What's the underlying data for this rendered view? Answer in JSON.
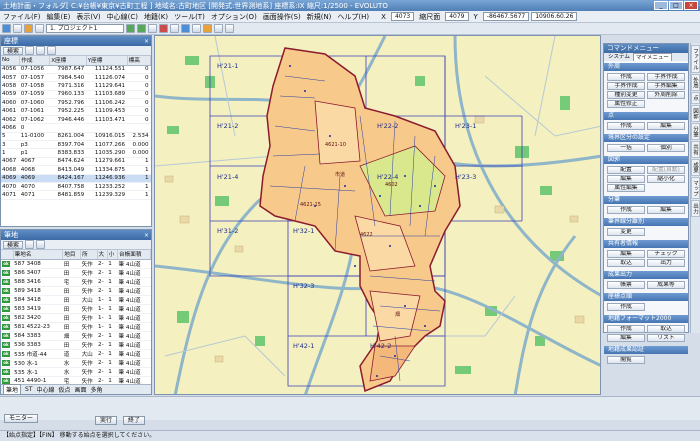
{
  "window": {
    "title": "土地計画・フォルダ[ C:¥台帳¥東京¥古町工程 ] 地域名:古町地区 [開発式:世界測地系] 座標系:IX 縮尺:1/2500 - EVOLUTO"
  },
  "menu": {
    "items": [
      "ファイル(F)",
      "編集(E)",
      "表示(V)",
      "中心線(C)",
      "地籍(K)",
      "ツール(T)",
      "オプション(O)",
      "画面操作(S)",
      "新規(N)",
      "ヘルプ(H)"
    ],
    "coords": [
      {
        "label": "X",
        "value": "4073"
      },
      {
        "label": "縮尺面",
        "value": "4079"
      },
      {
        "label": "Y",
        "value": "-86467.5677"
      },
      {
        "label": "",
        "value": "10906.60.26"
      }
    ]
  },
  "toolbar": {
    "project_dropdown": "1. プロジェクト1"
  },
  "coord_panel": {
    "title": "座標",
    "search_label": "検索",
    "columns": [
      "No",
      "作成",
      "X座標",
      "Y座標",
      "標高"
    ],
    "rows": [
      [
        "4056",
        "07-1056",
        "7987.647",
        "11124.551",
        "0"
      ],
      [
        "4057",
        "07-1057",
        "7984.540",
        "11126.074",
        "0"
      ],
      [
        "4058",
        "07-1058",
        "7971.316",
        "11129.641",
        "0"
      ],
      [
        "4059",
        "07-1059",
        "7960.133",
        "11103.689",
        "0"
      ],
      [
        "4060",
        "07-1060",
        "7952.796",
        "11106.242",
        "0"
      ],
      [
        "4061",
        "07-1061",
        "7952.225",
        "11109.453",
        "0"
      ],
      [
        "4062",
        "07-1062",
        "7946.446",
        "11103.471",
        "0"
      ],
      [
        "4066",
        "0",
        "",
        "",
        ""
      ],
      [
        "5",
        "11-0100",
        "8261.004",
        "10916.015",
        "2.534"
      ],
      [
        "3",
        "p3",
        "8397.704",
        "11077.266",
        "0.000"
      ],
      [
        "1",
        "p1",
        "8383.833",
        "11035.290",
        "0.000"
      ],
      [
        "4067",
        "4067",
        "8474.624",
        "11279.661",
        "1"
      ],
      [
        "4068",
        "4068",
        "8413.049",
        "11334.875",
        "1"
      ],
      [
        "4069",
        "4069",
        "8424.167",
        "11246.936",
        "1"
      ],
      [
        "4070",
        "4070",
        "8407.758",
        "11233.252",
        "1"
      ],
      [
        "4071",
        "4071",
        "8481.859",
        "11239.329",
        "1"
      ]
    ],
    "selected_row": 13
  },
  "lot_panel": {
    "title": "筆地",
    "search_label": "検索",
    "columns": [
      "",
      "筆地名",
      "地目",
      "所",
      "大",
      "小",
      "台帳面積"
    ],
    "rows": [
      [
        "ok",
        "587 3408",
        "田",
        "矢作",
        "2-",
        "1",
        "筆 4山道"
      ],
      [
        "ok",
        "586 3407",
        "田",
        "矢作",
        "2-",
        "1",
        "筆 4山道"
      ],
      [
        "ok",
        "588 3416",
        "宅",
        "矢作",
        "2-",
        "1",
        "筆 4山道"
      ],
      [
        "ok",
        "589 3418",
        "田",
        "矢作",
        "2-",
        "1",
        "筆 4山道"
      ],
      [
        "ok",
        "584 3418",
        "田",
        "大山",
        "1-",
        "1",
        "筆 4山道"
      ],
      [
        "ok",
        "583 3419",
        "田",
        "矢作",
        "1-",
        "1",
        "筆 4山道"
      ],
      [
        "ok",
        "582 3420",
        "田",
        "矢作",
        "1-",
        "1",
        "筆 4山道"
      ],
      [
        "ok",
        "581 4522-23",
        "田",
        "矢作",
        "1-",
        "1",
        "筆 4山道"
      ],
      [
        "ok",
        "584 3383",
        "畑",
        "矢作",
        "2-",
        "1",
        "筆 4山道"
      ],
      [
        "ok",
        "536 3383",
        "田",
        "矢作",
        "2-",
        "1",
        "筆 4山道"
      ],
      [
        "ok",
        "535 市道-44",
        "道",
        "大山",
        "2-",
        "1",
        "筆 4山道"
      ],
      [
        "ok",
        "530 水-1",
        "水",
        "矢作",
        "2-",
        "1",
        "筆 4山道"
      ],
      [
        "ok",
        "535 水-1",
        "水",
        "矢作",
        "2-",
        "1",
        "筆 4山道"
      ],
      [
        "ok",
        "451 4490-1",
        "宅",
        "矢作",
        "2-",
        "1",
        "筆 4山道"
      ]
    ]
  },
  "bottom_tabs": [
    "筆地",
    "ST",
    "中心線",
    "仮点",
    "画面",
    "多角"
  ],
  "map": {
    "grid_labels": [
      "H'21-1",
      "H'21-2",
      "H'22-2",
      "H'23-1",
      "H'21-4",
      "H'22-4",
      "H'23-3",
      "H'31-2",
      "H'32-1",
      "H'32-3",
      "H'42-1",
      "H'42-2"
    ],
    "parcel_labels": [
      "4621-10",
      "4621-15",
      "4602",
      "4622",
      "市道",
      "畑"
    ]
  },
  "command_panel": {
    "title": "コマンドメニュー",
    "tabs": [
      "システム",
      "マイメニュー"
    ],
    "sections": [
      {
        "name": "外周",
        "buttons": [
          "作成",
          "手界作成",
          "手界作成",
          "手界編集",
          "種別変更",
          "外周削除",
          "属性修正",
          ""
        ]
      },
      {
        "name": "点",
        "buttons": [
          "作成",
          "編集"
        ]
      },
      {
        "name": "境界区分の設定",
        "buttons": [
          "一括",
          "個別"
        ]
      },
      {
        "name": "図郭",
        "buttons": [
          "配置",
          "配置(自動)",
          "編集",
          "縮小化",
          "属性編集",
          ""
        ]
      },
      {
        "name": "分筆",
        "buttons": [
          "作成",
          "編集"
        ]
      },
      {
        "name": "筆界線分離別",
        "buttons": [
          "変更",
          ""
        ]
      },
      {
        "name": "共有者情報",
        "buttons": [
          "編集",
          "チェック",
          "取込",
          "出力"
        ]
      },
      {
        "name": "成果出力",
        "buttons": [
          "帳票",
          "成果等"
        ]
      },
      {
        "name": "座標点順",
        "buttons": [
          "作成",
          ""
        ]
      },
      {
        "name": "地籍フォーマット2000",
        "buttons": [
          "作成",
          "取込",
          "編集",
          "リスト"
        ]
      },
      {
        "name": "地籍成果認証",
        "buttons": [
          "閲覧",
          ""
        ]
      }
    ],
    "disabled": [
      "配置(自動)"
    ]
  },
  "side_tabs": [
    "ファイル",
    "外周",
    "点",
    "図郭",
    "分筆",
    "共有",
    "成果",
    "マップ",
    "出力"
  ],
  "status": {
    "monitor_button": "モニター",
    "exec_button": "実行",
    "exit_button": "終了",
    "message": "【始点指定】【FIN】 移動する始点を選択してください。"
  },
  "colors": {
    "parcel_fill": "#f7c98a",
    "parcel_border": "#8b1a2e",
    "grid_line": "#3b3fb8",
    "road": "#8fb5c8",
    "green": "#5ec46b",
    "map_bg": "#f4f0c0"
  }
}
